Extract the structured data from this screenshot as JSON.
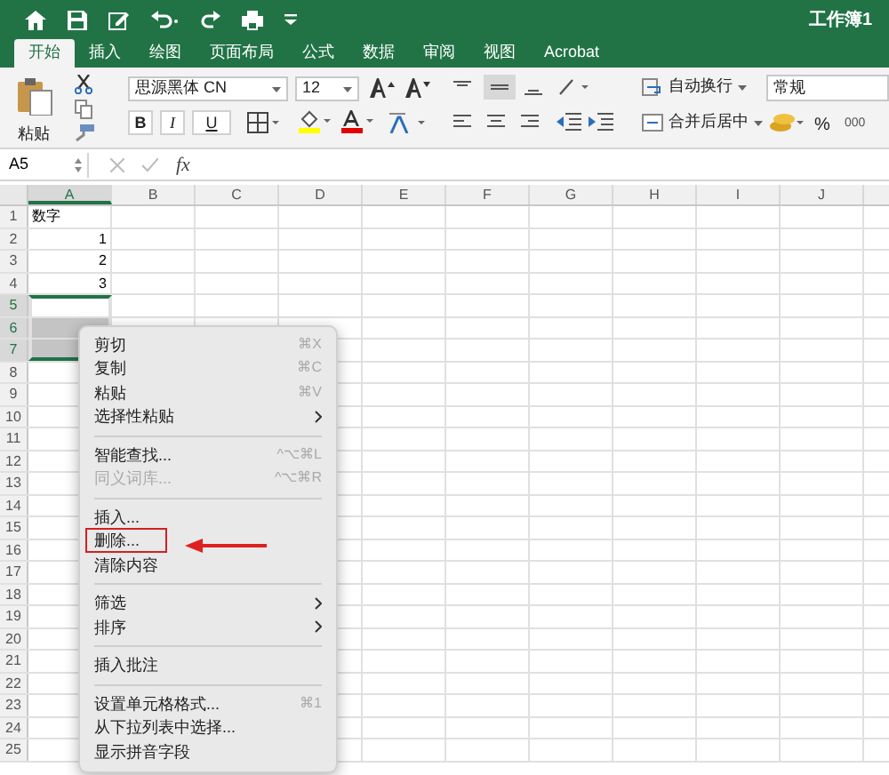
{
  "title_bar": {
    "title": "工作簿1"
  },
  "tabs": [
    {
      "label": "开始",
      "selected": true
    },
    {
      "label": "插入",
      "selected": false
    },
    {
      "label": "绘图",
      "selected": false
    },
    {
      "label": "页面布局",
      "selected": false
    },
    {
      "label": "公式",
      "selected": false
    },
    {
      "label": "数据",
      "selected": false
    },
    {
      "label": "审阅",
      "selected": false
    },
    {
      "label": "视图",
      "selected": false
    },
    {
      "label": "Acrobat",
      "selected": false
    }
  ],
  "ribbon": {
    "paste_label": "粘贴",
    "font_name": "思源黑体 CN",
    "font_size": "12",
    "bold": "B",
    "italic": "I",
    "underline": "U",
    "wrap_text": "自动换行",
    "merge_center": "合并后居中",
    "number_format": "常规",
    "percent": "%",
    "thousands": "000"
  },
  "formula_bar": {
    "name_box": "A5",
    "fx": "fx"
  },
  "columns": [
    {
      "label": "A",
      "selected": true
    },
    {
      "label": "B",
      "selected": false
    },
    {
      "label": "C",
      "selected": false
    },
    {
      "label": "D",
      "selected": false
    },
    {
      "label": "E",
      "selected": false
    },
    {
      "label": "F",
      "selected": false
    },
    {
      "label": "G",
      "selected": false
    },
    {
      "label": "H",
      "selected": false
    },
    {
      "label": "I",
      "selected": false
    },
    {
      "label": "J",
      "selected": false
    }
  ],
  "rows": [
    {
      "label": "1",
      "selected": false,
      "cell": {
        "value": "数字",
        "kind": "text"
      }
    },
    {
      "label": "2",
      "selected": false,
      "cell": {
        "value": "1",
        "kind": "number"
      }
    },
    {
      "label": "3",
      "selected": false,
      "cell": {
        "value": "2",
        "kind": "number"
      }
    },
    {
      "label": "4",
      "selected": false,
      "cell": {
        "value": "3",
        "kind": "number"
      }
    },
    {
      "label": "5",
      "selected": true
    },
    {
      "label": "6",
      "selected": true
    },
    {
      "label": "7",
      "selected": true
    },
    {
      "label": "8",
      "selected": false
    },
    {
      "label": "9",
      "selected": false
    },
    {
      "label": "10",
      "selected": false
    },
    {
      "label": "11",
      "selected": false
    },
    {
      "label": "12",
      "selected": false
    },
    {
      "label": "13",
      "selected": false
    },
    {
      "label": "14",
      "selected": false
    },
    {
      "label": "15",
      "selected": false
    },
    {
      "label": "16",
      "selected": false
    },
    {
      "label": "17",
      "selected": false
    },
    {
      "label": "18",
      "selected": false
    },
    {
      "label": "19",
      "selected": false
    },
    {
      "label": "20",
      "selected": false
    },
    {
      "label": "21",
      "selected": false
    },
    {
      "label": "22",
      "selected": false
    },
    {
      "label": "23",
      "selected": false
    },
    {
      "label": "24",
      "selected": false
    },
    {
      "label": "25",
      "selected": false
    }
  ],
  "context_menu": [
    {
      "kind": "item",
      "label": "剪切",
      "shortcut": "⌘X",
      "disabled": false,
      "highlighted": false
    },
    {
      "kind": "item",
      "label": "复制",
      "shortcut": "⌘C",
      "disabled": false,
      "highlighted": false
    },
    {
      "kind": "item",
      "label": "粘贴",
      "shortcut": "⌘V",
      "disabled": false,
      "highlighted": false
    },
    {
      "kind": "submenu",
      "label": "选择性粘贴",
      "disabled": false,
      "highlighted": false
    },
    {
      "kind": "separator"
    },
    {
      "kind": "item",
      "label": "智能查找...",
      "shortcut": "^⌥⌘L",
      "disabled": false,
      "highlighted": false
    },
    {
      "kind": "item",
      "label": "同义词库...",
      "shortcut": "^⌥⌘R",
      "disabled": true,
      "highlighted": false
    },
    {
      "kind": "separator"
    },
    {
      "kind": "item",
      "label": "插入...",
      "disabled": false,
      "highlighted": false
    },
    {
      "kind": "item",
      "label": "删除...",
      "disabled": false,
      "highlighted": true
    },
    {
      "kind": "item",
      "label": "清除内容",
      "disabled": false,
      "highlighted": false
    },
    {
      "kind": "separator"
    },
    {
      "kind": "submenu",
      "label": "筛选",
      "disabled": false,
      "highlighted": false
    },
    {
      "kind": "submenu",
      "label": "排序",
      "disabled": false,
      "highlighted": false
    },
    {
      "kind": "separator"
    },
    {
      "kind": "item",
      "label": "插入批注",
      "disabled": false,
      "highlighted": false
    },
    {
      "kind": "separator"
    },
    {
      "kind": "item",
      "label": "设置单元格格式...",
      "shortcut": "⌘1",
      "disabled": false,
      "highlighted": false
    },
    {
      "kind": "item",
      "label": "从下拉列表中选择...",
      "disabled": false,
      "highlighted": false
    },
    {
      "kind": "item",
      "label": "显示拼音字段",
      "disabled": false,
      "highlighted": false
    }
  ]
}
